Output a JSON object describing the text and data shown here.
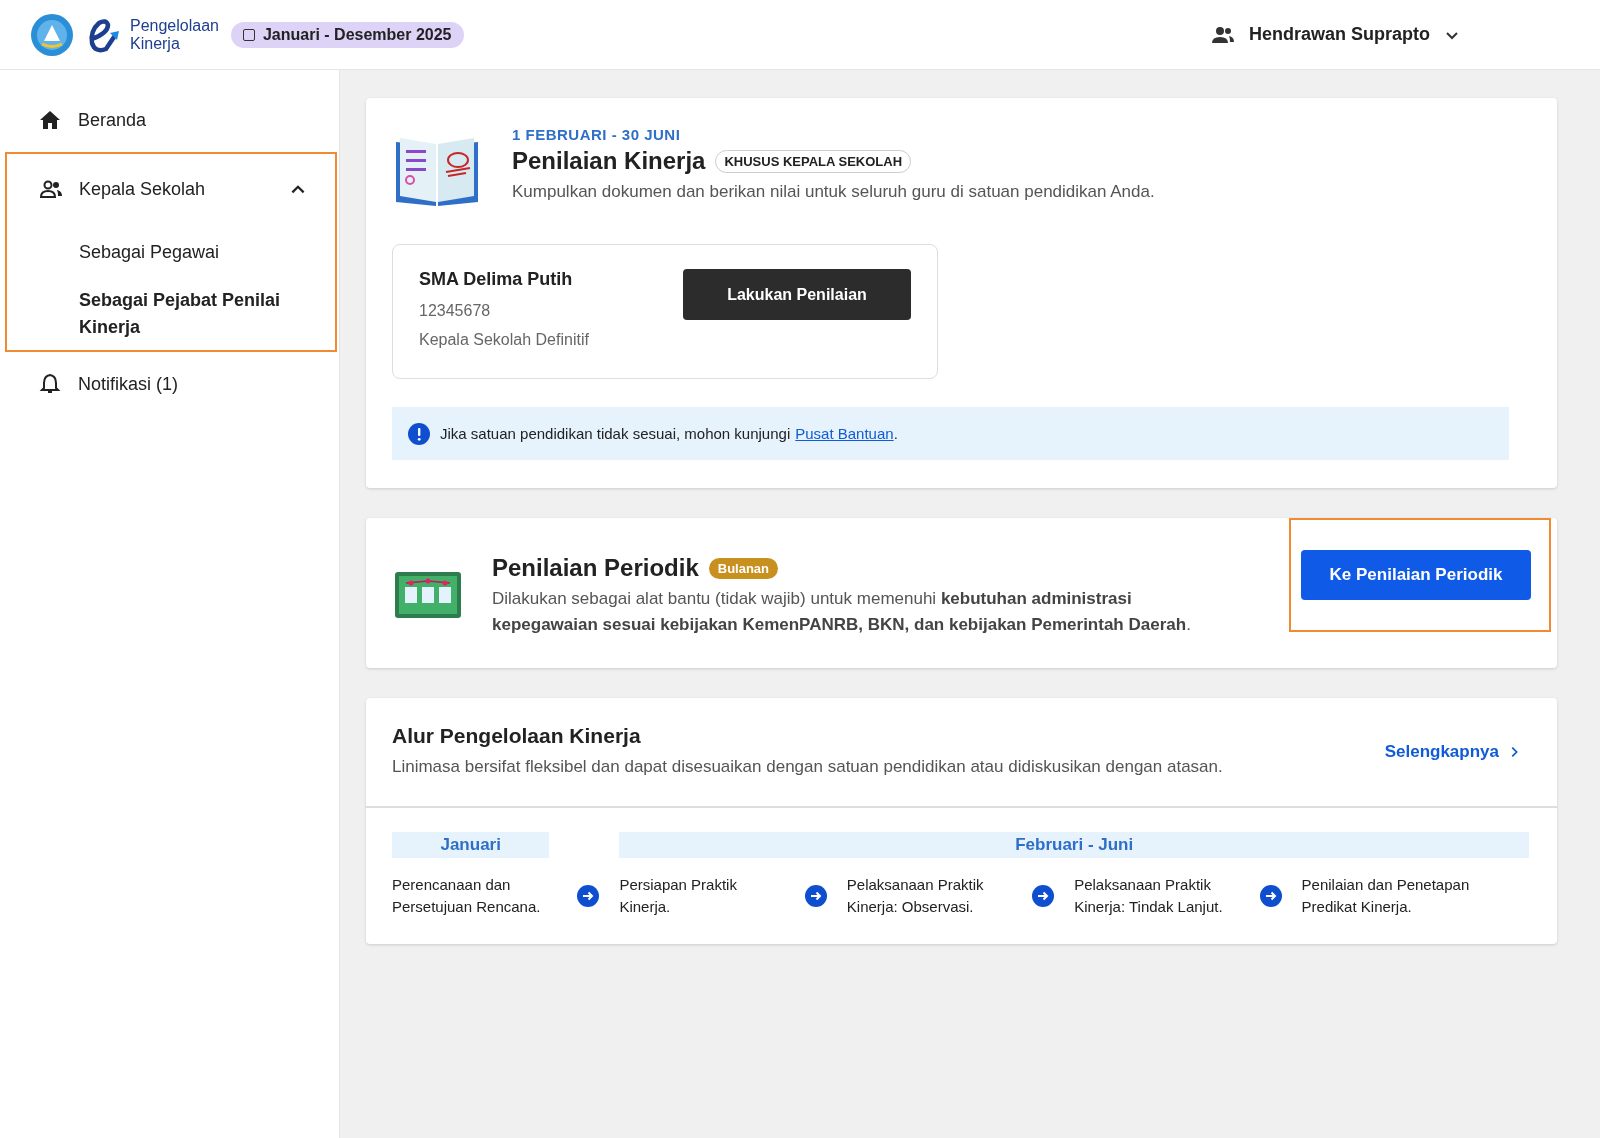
{
  "header": {
    "app_name_line1": "Pengelolaan",
    "app_name_line2": "Kinerja",
    "period": "Januari - Desember 2025",
    "user": "Hendrawan Suprapto"
  },
  "sidebar": {
    "items": [
      {
        "kind": "link",
        "label": "Beranda",
        "selected": false
      },
      {
        "kind": "group",
        "label": "Kepala Sekolah",
        "expanded": true,
        "highlighted": true,
        "children": [
          {
            "label": "Sebagai Pegawai",
            "selected": false
          },
          {
            "label": "Sebagai Pejabat Penilai Kinerja",
            "selected": true
          }
        ]
      },
      {
        "kind": "link",
        "label": "Notifikasi (1)",
        "selected": false
      }
    ]
  },
  "assessment": {
    "date_range": "1 FEBRUARI - 30 JUNI",
    "title": "Penilaian Kinerja",
    "badge": "KHUSUS KEPALA SEKOLAH",
    "description": "Kumpulkan dokumen dan berikan nilai untuk seluruh guru di satuan pendidikan Anda.",
    "school": {
      "name": "SMA Delima Putih",
      "id": "12345678",
      "role": "Kepala Sekolah Definitif",
      "button": "Lakukan Penilaian"
    },
    "notice": {
      "text": "Jika satuan pendidikan tidak sesuai, mohon kunjungi",
      "link": "Pusat Bantuan",
      "end": "."
    }
  },
  "periodic": {
    "title": "Penilaian Periodik",
    "badge": "Bulanan",
    "description": "Dilakukan sebagai alat bantu (tidak wajib) untuk memenuhi **kebutuhan administrasi kepegawaian sesuai kebijakan KemenPANRB, BKN, dan kebijakan Pemerintah Daerah**.",
    "button": "Ke Penilaian Periodik",
    "button_highlighted": true
  },
  "flow": {
    "title": "Alur Pengelolaan Kinerja",
    "description": "Linimasa bersifat fleksibel dan dapat disesuaikan dengan satuan pendidikan atau didiskusikan dengan atasan.",
    "more": "Selengkapnya",
    "phases": [
      {
        "label": "Januari",
        "steps": [
          "Perencanaan dan Persetujuan Rencana."
        ]
      },
      {
        "label": "Februari - Juni",
        "steps": [
          "Persiapan Praktik Kinerja.",
          "Pelaksanaan Praktik Kinerja: Observasi.",
          "Pelaksanaan Praktik Kinerja: Tindak Lanjut.",
          "Penilaian dan Penetapan Predikat Kinerja."
        ]
      }
    ]
  }
}
